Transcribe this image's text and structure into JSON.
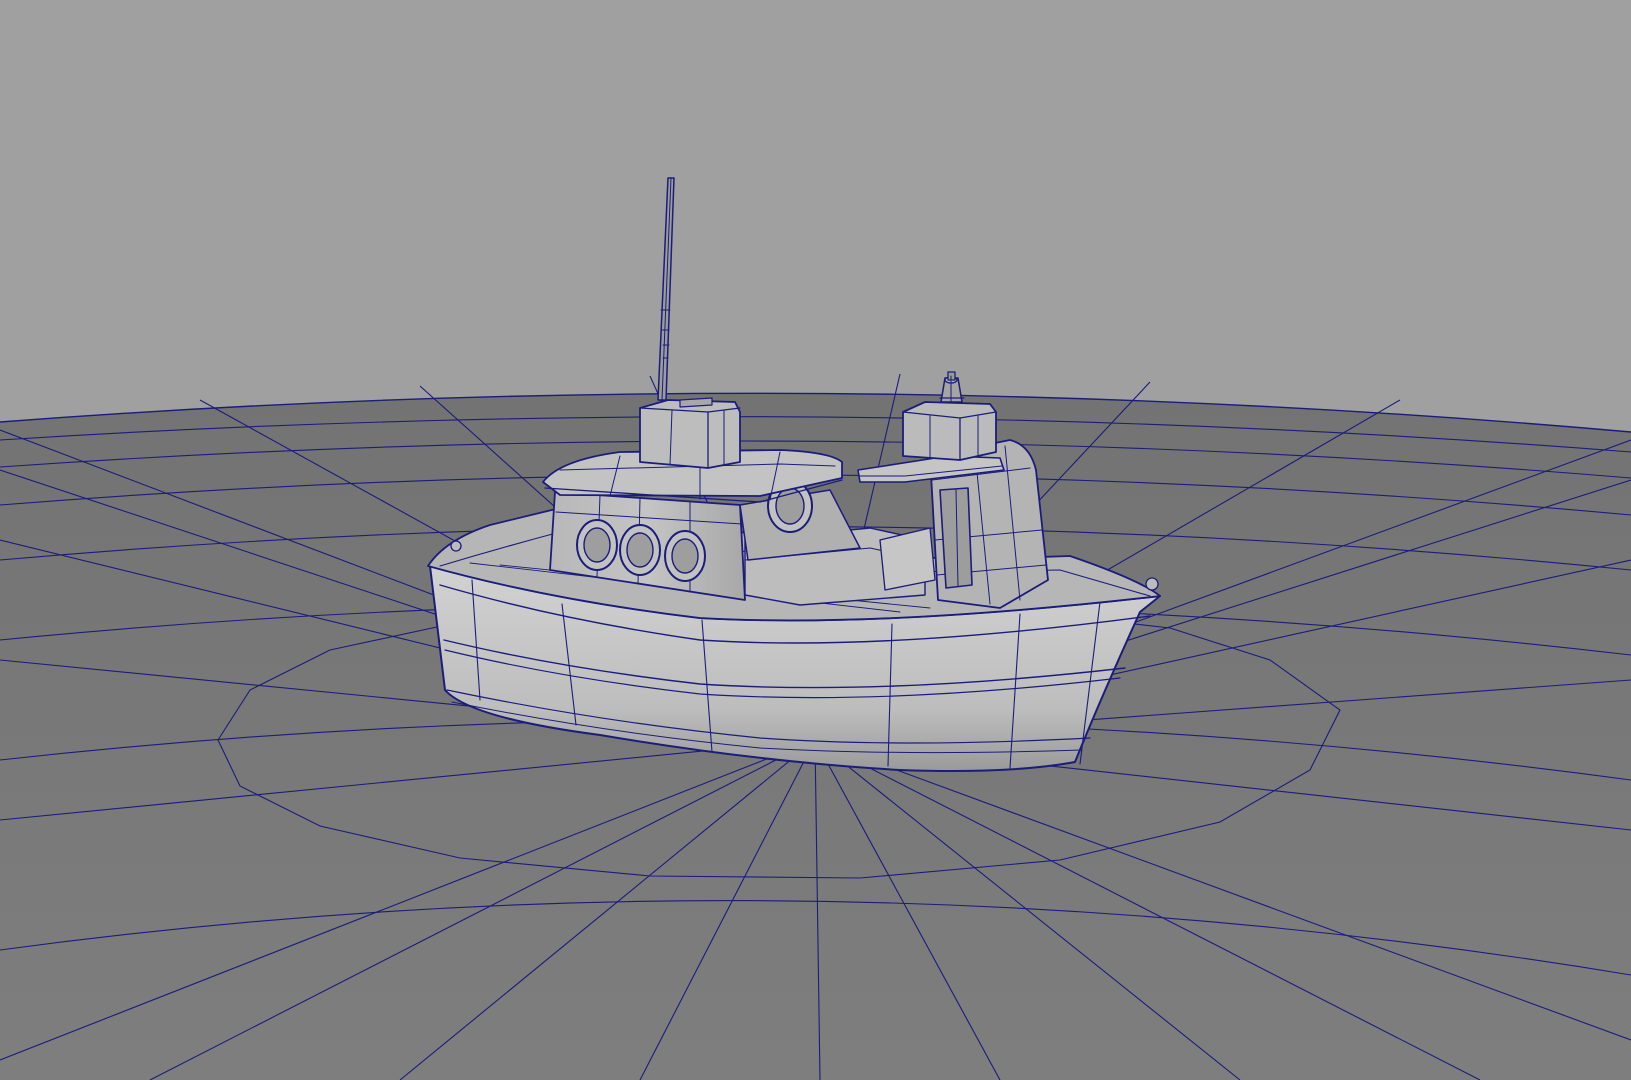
{
  "viewport": {
    "view": "perspective",
    "display_mode": "wireframe-on-shaded",
    "colors": {
      "background": "#a0a0a0",
      "ground_plane": "#7a7a7a",
      "wireframe": "#1c1c7a",
      "model_surface": "#c9c9c9",
      "model_shadow": "#8f8f8f"
    }
  },
  "scene": {
    "objects": [
      {
        "name": "ground-plane",
        "type": "disc-polygon-mesh"
      },
      {
        "name": "toy-boat",
        "type": "polygon-mesh",
        "parts": [
          "hull",
          "deck",
          "cabin",
          "cabin-roof",
          "antenna-mast",
          "portholes",
          "smokestack",
          "rear-platform"
        ]
      }
    ]
  }
}
